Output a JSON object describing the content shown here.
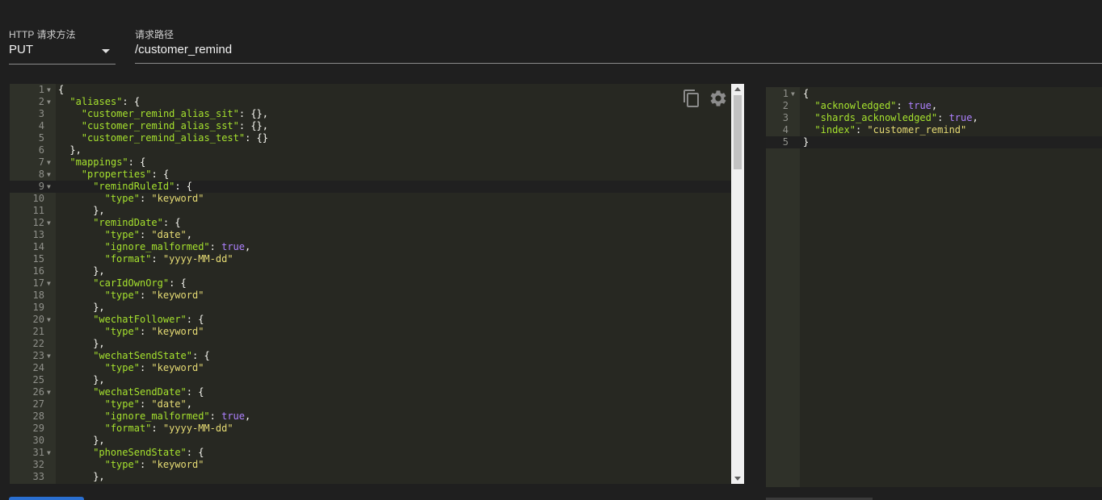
{
  "form": {
    "method_label": "HTTP 请求方法",
    "method_value": "PUT",
    "path_label": "请求路径",
    "path_value": "/customer_remind"
  },
  "request_editor": {
    "active_line": 9,
    "lines": [
      {
        "n": "1",
        "fold": true,
        "indent": 0,
        "tokens": [
          {
            "t": "p",
            "v": "{"
          }
        ]
      },
      {
        "n": "2",
        "fold": true,
        "indent": 1,
        "tokens": [
          {
            "t": "k",
            "v": "\"aliases\""
          },
          {
            "t": "p",
            "v": ": {"
          }
        ]
      },
      {
        "n": "3",
        "fold": false,
        "indent": 2,
        "tokens": [
          {
            "t": "k",
            "v": "\"customer_remind_alias_sit\""
          },
          {
            "t": "p",
            "v": ": {},"
          }
        ]
      },
      {
        "n": "4",
        "fold": false,
        "indent": 2,
        "tokens": [
          {
            "t": "k",
            "v": "\"customer_remind_alias_sst\""
          },
          {
            "t": "p",
            "v": ": {},"
          }
        ]
      },
      {
        "n": "5",
        "fold": false,
        "indent": 2,
        "tokens": [
          {
            "t": "k",
            "v": "\"customer_remind_alias_test\""
          },
          {
            "t": "p",
            "v": ": {}"
          }
        ]
      },
      {
        "n": "6",
        "fold": false,
        "indent": 1,
        "tokens": [
          {
            "t": "p",
            "v": "},"
          }
        ]
      },
      {
        "n": "7",
        "fold": true,
        "indent": 1,
        "tokens": [
          {
            "t": "k",
            "v": "\"mappings\""
          },
          {
            "t": "p",
            "v": ": {"
          }
        ]
      },
      {
        "n": "8",
        "fold": true,
        "indent": 2,
        "tokens": [
          {
            "t": "k",
            "v": "\"properties\""
          },
          {
            "t": "p",
            "v": ": {"
          }
        ]
      },
      {
        "n": "9",
        "fold": true,
        "indent": 3,
        "tokens": [
          {
            "t": "k",
            "v": "\"remindRuleId\""
          },
          {
            "t": "p",
            "v": ": {"
          }
        ]
      },
      {
        "n": "10",
        "fold": false,
        "indent": 4,
        "tokens": [
          {
            "t": "k",
            "v": "\"type\""
          },
          {
            "t": "p",
            "v": ": "
          },
          {
            "t": "s",
            "v": "\"keyword\""
          }
        ]
      },
      {
        "n": "11",
        "fold": false,
        "indent": 3,
        "tokens": [
          {
            "t": "p",
            "v": "},"
          }
        ]
      },
      {
        "n": "12",
        "fold": true,
        "indent": 3,
        "tokens": [
          {
            "t": "k",
            "v": "\"remindDate\""
          },
          {
            "t": "p",
            "v": ": {"
          }
        ]
      },
      {
        "n": "13",
        "fold": false,
        "indent": 4,
        "tokens": [
          {
            "t": "k",
            "v": "\"type\""
          },
          {
            "t": "p",
            "v": ": "
          },
          {
            "t": "s",
            "v": "\"date\""
          },
          {
            "t": "p",
            "v": ","
          }
        ]
      },
      {
        "n": "14",
        "fold": false,
        "indent": 4,
        "tokens": [
          {
            "t": "k",
            "v": "\"ignore_malformed\""
          },
          {
            "t": "p",
            "v": ": "
          },
          {
            "t": "b",
            "v": "true"
          },
          {
            "t": "p",
            "v": ","
          }
        ]
      },
      {
        "n": "15",
        "fold": false,
        "indent": 4,
        "tokens": [
          {
            "t": "k",
            "v": "\"format\""
          },
          {
            "t": "p",
            "v": ": "
          },
          {
            "t": "s",
            "v": "\"yyyy-MM-dd\""
          }
        ]
      },
      {
        "n": "16",
        "fold": false,
        "indent": 3,
        "tokens": [
          {
            "t": "p",
            "v": "},"
          }
        ]
      },
      {
        "n": "17",
        "fold": true,
        "indent": 3,
        "tokens": [
          {
            "t": "k",
            "v": "\"carIdOwnOrg\""
          },
          {
            "t": "p",
            "v": ": {"
          }
        ]
      },
      {
        "n": "18",
        "fold": false,
        "indent": 4,
        "tokens": [
          {
            "t": "k",
            "v": "\"type\""
          },
          {
            "t": "p",
            "v": ": "
          },
          {
            "t": "s",
            "v": "\"keyword\""
          }
        ]
      },
      {
        "n": "19",
        "fold": false,
        "indent": 3,
        "tokens": [
          {
            "t": "p",
            "v": "},"
          }
        ]
      },
      {
        "n": "20",
        "fold": true,
        "indent": 3,
        "tokens": [
          {
            "t": "k",
            "v": "\"wechatFollower\""
          },
          {
            "t": "p",
            "v": ": {"
          }
        ]
      },
      {
        "n": "21",
        "fold": false,
        "indent": 4,
        "tokens": [
          {
            "t": "k",
            "v": "\"type\""
          },
          {
            "t": "p",
            "v": ": "
          },
          {
            "t": "s",
            "v": "\"keyword\""
          }
        ]
      },
      {
        "n": "22",
        "fold": false,
        "indent": 3,
        "tokens": [
          {
            "t": "p",
            "v": "},"
          }
        ]
      },
      {
        "n": "23",
        "fold": true,
        "indent": 3,
        "tokens": [
          {
            "t": "k",
            "v": "\"wechatSendState\""
          },
          {
            "t": "p",
            "v": ": {"
          }
        ]
      },
      {
        "n": "24",
        "fold": false,
        "indent": 4,
        "tokens": [
          {
            "t": "k",
            "v": "\"type\""
          },
          {
            "t": "p",
            "v": ": "
          },
          {
            "t": "s",
            "v": "\"keyword\""
          }
        ]
      },
      {
        "n": "25",
        "fold": false,
        "indent": 3,
        "tokens": [
          {
            "t": "p",
            "v": "},"
          }
        ]
      },
      {
        "n": "26",
        "fold": true,
        "indent": 3,
        "tokens": [
          {
            "t": "k",
            "v": "\"wechatSendDate\""
          },
          {
            "t": "p",
            "v": ": {"
          }
        ]
      },
      {
        "n": "27",
        "fold": false,
        "indent": 4,
        "tokens": [
          {
            "t": "k",
            "v": "\"type\""
          },
          {
            "t": "p",
            "v": ": "
          },
          {
            "t": "s",
            "v": "\"date\""
          },
          {
            "t": "p",
            "v": ","
          }
        ]
      },
      {
        "n": "28",
        "fold": false,
        "indent": 4,
        "tokens": [
          {
            "t": "k",
            "v": "\"ignore_malformed\""
          },
          {
            "t": "p",
            "v": ": "
          },
          {
            "t": "b",
            "v": "true"
          },
          {
            "t": "p",
            "v": ","
          }
        ]
      },
      {
        "n": "29",
        "fold": false,
        "indent": 4,
        "tokens": [
          {
            "t": "k",
            "v": "\"format\""
          },
          {
            "t": "p",
            "v": ": "
          },
          {
            "t": "s",
            "v": "\"yyyy-MM-dd\""
          }
        ]
      },
      {
        "n": "30",
        "fold": false,
        "indent": 3,
        "tokens": [
          {
            "t": "p",
            "v": "},"
          }
        ]
      },
      {
        "n": "31",
        "fold": true,
        "indent": 3,
        "tokens": [
          {
            "t": "k",
            "v": "\"phoneSendState\""
          },
          {
            "t": "p",
            "v": ": {"
          }
        ]
      },
      {
        "n": "32",
        "fold": false,
        "indent": 4,
        "tokens": [
          {
            "t": "k",
            "v": "\"type\""
          },
          {
            "t": "p",
            "v": ": "
          },
          {
            "t": "s",
            "v": "\"keyword\""
          }
        ]
      },
      {
        "n": "33",
        "fold": false,
        "indent": 3,
        "tokens": [
          {
            "t": "p",
            "v": "},"
          }
        ]
      }
    ],
    "icons": [
      "copy-icon",
      "gear-icon"
    ]
  },
  "response_editor": {
    "active_line": 5,
    "lines": [
      {
        "n": "1",
        "fold": true,
        "indent": 0,
        "tokens": [
          {
            "t": "p",
            "v": "{"
          }
        ]
      },
      {
        "n": "2",
        "fold": false,
        "indent": 1,
        "tokens": [
          {
            "t": "k",
            "v": "\"acknowledged\""
          },
          {
            "t": "p",
            "v": ": "
          },
          {
            "t": "b",
            "v": "true"
          },
          {
            "t": "p",
            "v": ","
          }
        ]
      },
      {
        "n": "3",
        "fold": false,
        "indent": 1,
        "tokens": [
          {
            "t": "k",
            "v": "\"shards_acknowledged\""
          },
          {
            "t": "p",
            "v": ": "
          },
          {
            "t": "b",
            "v": "true"
          },
          {
            "t": "p",
            "v": ","
          }
        ]
      },
      {
        "n": "4",
        "fold": false,
        "indent": 1,
        "tokens": [
          {
            "t": "k",
            "v": "\"index\""
          },
          {
            "t": "p",
            "v": ": "
          },
          {
            "t": "s",
            "v": "\"customer_remind\""
          }
        ]
      },
      {
        "n": "5",
        "fold": false,
        "indent": 0,
        "tokens": [
          {
            "t": "p",
            "v": "}"
          }
        ]
      }
    ]
  },
  "colors": {
    "editor_bg": "#272822",
    "gutter_bg": "#2f3129",
    "key": "#a6e22e",
    "string": "#e6db74",
    "boolean": "#ae81ff",
    "accent": "#2a6fd1"
  }
}
